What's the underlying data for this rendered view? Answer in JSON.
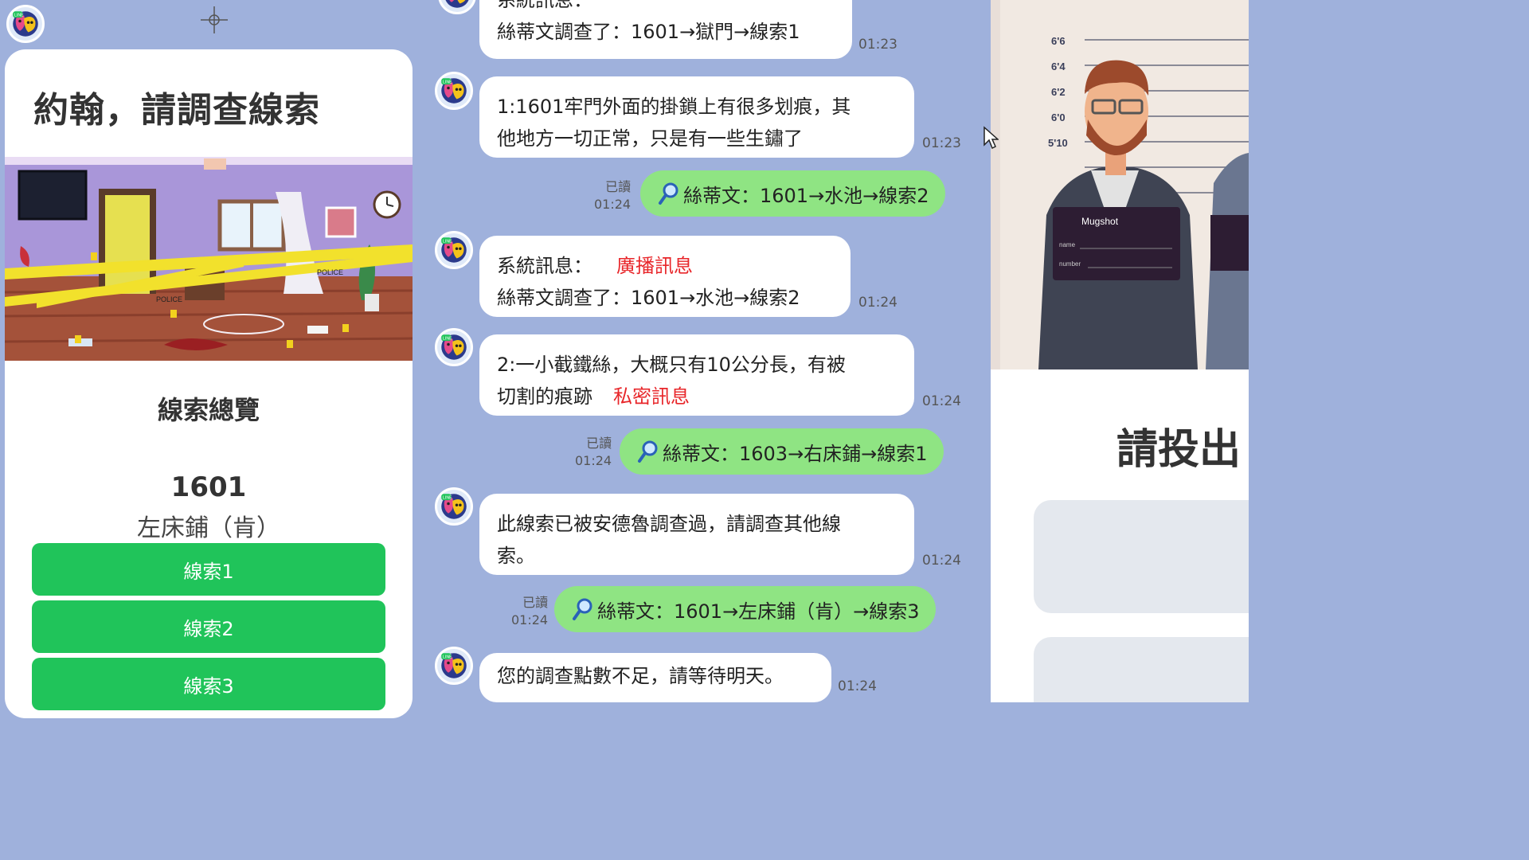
{
  "left": {
    "title": "約翰，請調查線索",
    "overview_title": "線索總覽",
    "room_number": "1601",
    "location": "左床鋪（肯）",
    "clue_buttons": [
      "線索1",
      "線索2",
      "線索3"
    ],
    "scene_labels": {
      "police": "POLICE"
    }
  },
  "chat": {
    "messages": [
      {
        "lines": [
          "系統訊息：",
          "絲蒂文調查了：1601→獄門→線索1"
        ],
        "time": "01:23"
      },
      {
        "lines": [
          "1:1601牢門外面的掛鎖上有很多划痕，其",
          "他地方一切正常，只是有一些生鏽了"
        ],
        "time": "01:23"
      },
      {
        "sent": "絲蒂文：1601→水池→線索2",
        "read": "已讀",
        "time": "01:24"
      },
      {
        "label": "系統訊息：",
        "tag": "廣播訊息",
        "line2": "絲蒂文調查了：1601→水池→線索2",
        "time": "01:24"
      },
      {
        "line1": "2:一小截鐵絲，大概只有10公分長，有被",
        "line2": "切割的痕跡",
        "tag": "私密訊息",
        "time": "01:24"
      },
      {
        "sent": "絲蒂文：1603→右床鋪→線索1",
        "read": "已讀",
        "time": "01:24"
      },
      {
        "lines": [
          "此線索已被安德魯調查過，請調查其他線",
          "索。"
        ],
        "time": "01:24"
      },
      {
        "sent": "絲蒂文：1601→左床鋪（肯）→線索3",
        "read": "已讀",
        "time": "01:24"
      },
      {
        "lines": [
          "您的調查點數不足，請等待明天。"
        ],
        "time": "01:24"
      }
    ]
  },
  "right": {
    "vote_title": "請投出",
    "mugshot_board": "Mugshot",
    "board_fields": [
      "name",
      "number"
    ],
    "heights": [
      "6'6",
      "6'4",
      "6'2",
      "6'0",
      "5'10"
    ]
  },
  "colors": {
    "background": "#9fb1dc",
    "clue_button": "#20c45a",
    "sent_bubble": "#8fe483",
    "alert_red": "#e8262a"
  },
  "icons": [
    "bot-avatar-icon",
    "magnifier-icon",
    "crosshair-icon",
    "mouse-cursor-icon"
  ]
}
